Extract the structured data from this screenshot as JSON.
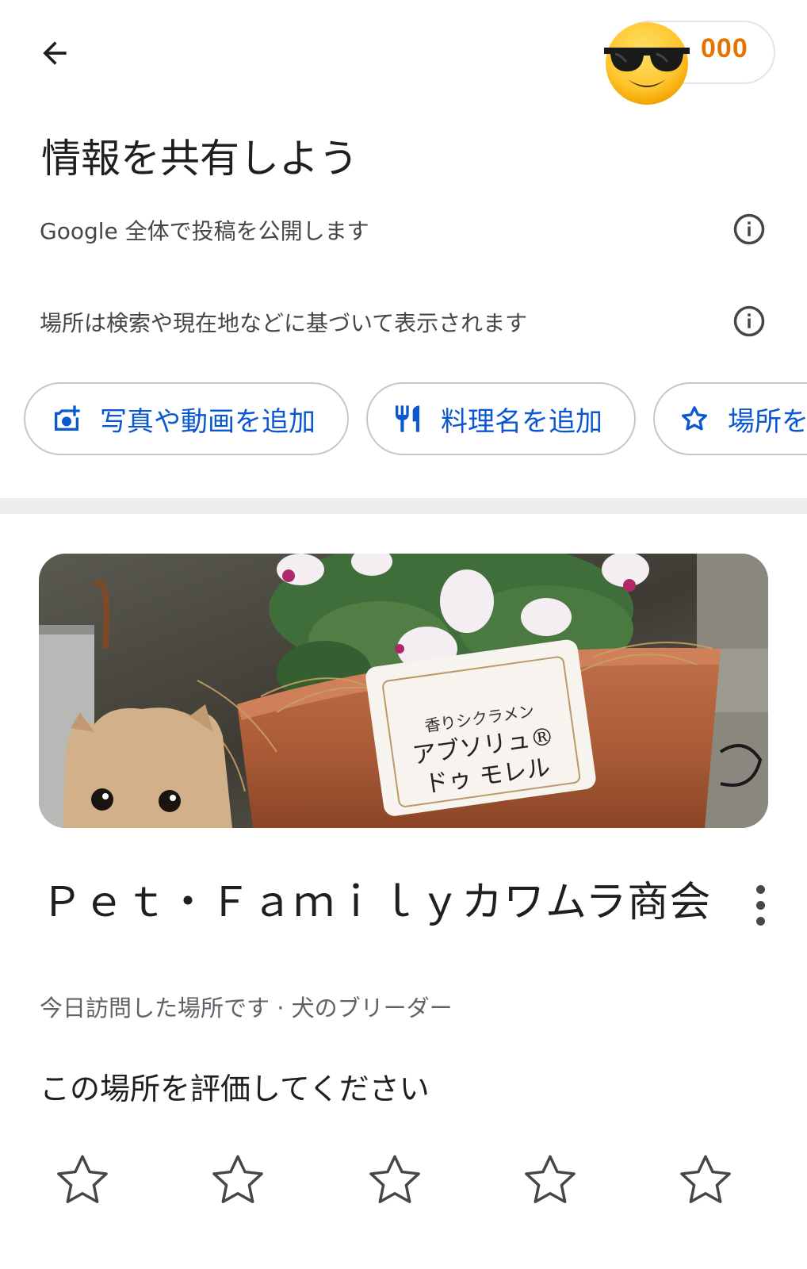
{
  "header": {
    "back_icon": "arrow-left-icon",
    "points": "000",
    "avatar_icon": "sunglasses-emoji"
  },
  "page": {
    "title": "情報を共有しよう"
  },
  "info": [
    {
      "text": "Google 全体で投稿を公開します",
      "icon": "info-icon"
    },
    {
      "text": "場所は検索や現在地などに基づいて表示されます",
      "icon": "info-icon"
    }
  ],
  "chips": [
    {
      "label": "写真や動画を追加",
      "icon": "add-photo-icon"
    },
    {
      "label": "料理名を追加",
      "icon": "restaurant-icon"
    },
    {
      "label": "場所を",
      "icon": "star-outline-icon"
    }
  ],
  "place": {
    "name": "Ｐｅｔ・Ｆａｍｉｌｙカワムラ商会",
    "subtitle": "今日訪問した場所です · 犬のブリーダー",
    "photo_sign_line1": "香りシクラメン",
    "photo_sign_line2": "アブソリュ®",
    "photo_sign_line3": "ドゥ モレル"
  },
  "rating": {
    "prompt": "この場所を評価してください",
    "stars_total": 5,
    "stars_selected": 0
  },
  "colors": {
    "accent": "#0b57d0",
    "points": "#e37400",
    "text_primary": "#1f1f1f",
    "text_secondary": "#5f6368"
  }
}
